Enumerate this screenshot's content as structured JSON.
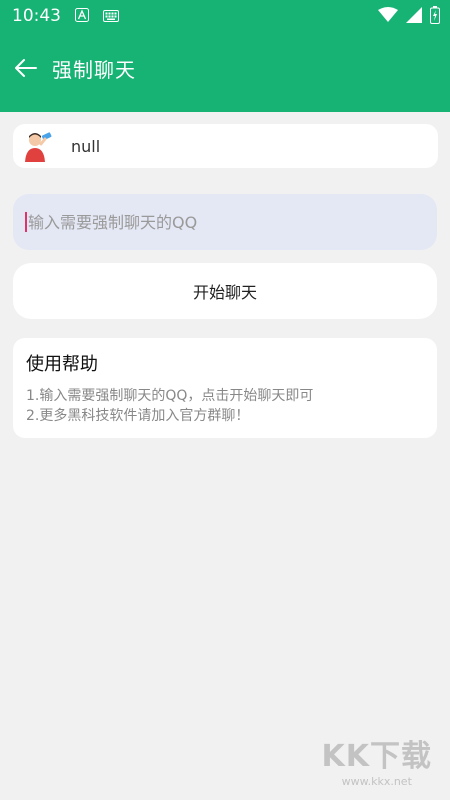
{
  "status_bar": {
    "time": "10:43"
  },
  "header": {
    "title": "强制聊天"
  },
  "profile": {
    "name": "null"
  },
  "qq_input": {
    "placeholder": "输入需要强制聊天的QQ"
  },
  "start_button": {
    "label": "开始聊天"
  },
  "help": {
    "title": "使用帮助",
    "lines": [
      "1.输入需要强制聊天的QQ，点击开始聊天即可",
      "2.更多黑科技软件请加入官方群聊！"
    ]
  },
  "watermark": {
    "logo": "KK下载",
    "url": "www.kkx.net"
  },
  "colors": {
    "primary": "#16b374",
    "input_bg": "#e4e7f4",
    "caret": "#e0336a",
    "background": "#f1f1f1"
  }
}
